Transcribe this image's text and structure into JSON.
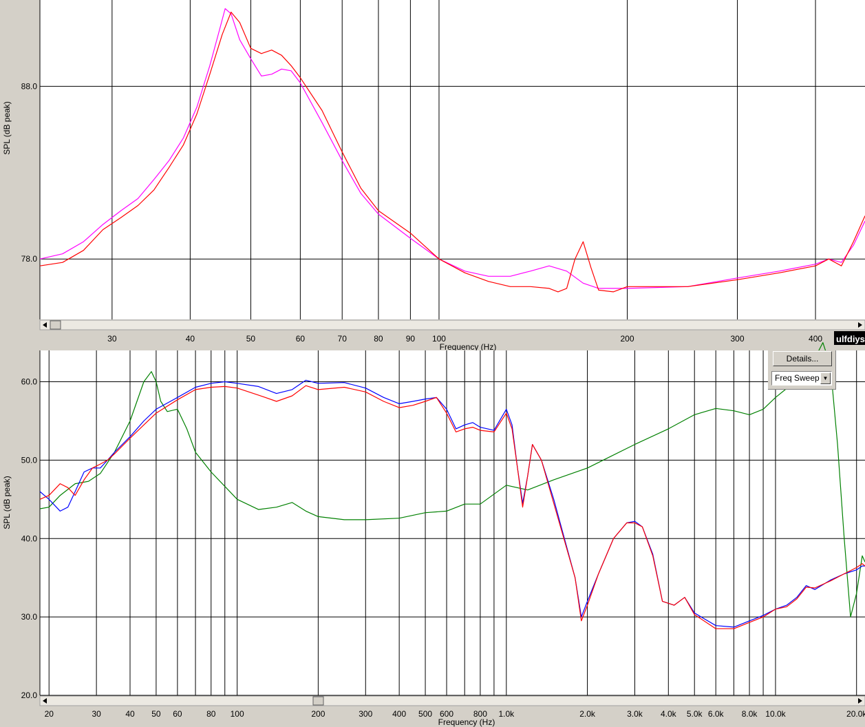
{
  "brand_text": "ulfdiys",
  "colors": {
    "background": "#d4d0c8",
    "plot_bg": "#ffffff",
    "grid": "#000000",
    "red": "#ff0000",
    "magenta": "#ff00ff",
    "blue": "#0000ff",
    "green": "#008000"
  },
  "controls": {
    "details_label": "Details...",
    "mode_value": "Freq Sweep"
  },
  "chart_data": [
    {
      "type": "line",
      "xlabel": "Frequency (Hz)",
      "ylabel": "SPL (dB peak)",
      "x_scale": "log",
      "xlim": [
        23,
        480
      ],
      "ylim": [
        74.5,
        93.0
      ],
      "x_ticks": [
        {
          "v": 30,
          "label": "30"
        },
        {
          "v": 40,
          "label": "40"
        },
        {
          "v": 50,
          "label": "50"
        },
        {
          "v": 60,
          "label": "60"
        },
        {
          "v": 70,
          "label": "70"
        },
        {
          "v": 80,
          "label": "80"
        },
        {
          "v": 90,
          "label": "90"
        },
        {
          "v": 100,
          "label": "100"
        },
        {
          "v": 200,
          "label": "200"
        },
        {
          "v": 300,
          "label": "300"
        },
        {
          "v": 400,
          "label": "400"
        }
      ],
      "y_ticks": [
        {
          "v": 78.0,
          "label": "78.0"
        },
        {
          "v": 88.0,
          "label": "88.0"
        }
      ],
      "series": [
        {
          "color": "#ff00ff",
          "x": [
            23,
            25,
            27,
            29,
            31,
            33,
            35,
            37,
            39,
            41,
            43,
            44.5,
            45.5,
            46.5,
            48,
            50,
            52,
            54,
            56,
            58,
            60,
            65,
            70,
            75,
            80,
            90,
            100,
            110,
            120,
            130,
            140,
            150,
            160,
            170,
            180,
            190,
            200,
            250,
            300,
            350,
            400,
            420,
            440,
            460,
            480
          ],
          "y": [
            78.0,
            78.3,
            79.0,
            80.0,
            80.8,
            81.5,
            82.6,
            83.7,
            85.0,
            86.8,
            89.2,
            91.2,
            92.5,
            92.2,
            90.7,
            89.6,
            88.6,
            88.7,
            89.0,
            88.9,
            88.2,
            85.9,
            83.7,
            81.8,
            80.6,
            79.2,
            78.0,
            77.3,
            77.0,
            77.0,
            77.3,
            77.6,
            77.3,
            76.6,
            76.3,
            76.3,
            76.3,
            76.4,
            76.9,
            77.3,
            77.7,
            78.0,
            77.8,
            78.8,
            80.2
          ]
        },
        {
          "color": "#ff0000",
          "x": [
            23,
            25,
            27,
            29,
            31,
            33,
            35,
            37,
            39,
            41,
            43,
            45,
            46.5,
            48,
            50,
            52,
            54,
            56,
            58,
            60,
            65,
            70,
            75,
            80,
            90,
            100,
            110,
            120,
            130,
            140,
            150,
            155,
            160,
            165,
            170,
            175,
            180,
            190,
            200,
            250,
            300,
            350,
            400,
            420,
            440,
            460,
            480
          ],
          "y": [
            77.6,
            77.8,
            78.5,
            79.7,
            80.4,
            81.1,
            82.0,
            83.3,
            84.6,
            86.4,
            88.7,
            91.0,
            92.3,
            91.7,
            90.2,
            89.9,
            90.1,
            89.8,
            89.2,
            88.5,
            86.6,
            84.2,
            82.1,
            80.8,
            79.5,
            78.0,
            77.2,
            76.7,
            76.4,
            76.4,
            76.3,
            76.1,
            76.3,
            78.0,
            79.0,
            77.5,
            76.2,
            76.1,
            76.4,
            76.4,
            76.8,
            77.2,
            77.6,
            78.0,
            77.6,
            79.0,
            80.5
          ]
        }
      ]
    },
    {
      "type": "line",
      "xlabel": "Frequency (Hz)",
      "ylabel": "SPL (dB peak)",
      "x_scale": "log",
      "xlim": [
        18.5,
        21500
      ],
      "ylim": [
        20.0,
        64.0
      ],
      "x_ticks": [
        {
          "v": 20,
          "label": "20"
        },
        {
          "v": 30,
          "label": "30"
        },
        {
          "v": 40,
          "label": "40"
        },
        {
          "v": 50,
          "label": "50"
        },
        {
          "v": 60,
          "label": "60"
        },
        {
          "v": 80,
          "label": "80"
        },
        {
          "v": 100,
          "label": "100"
        },
        {
          "v": 200,
          "label": "200"
        },
        {
          "v": 300,
          "label": "300"
        },
        {
          "v": 400,
          "label": "400"
        },
        {
          "v": 500,
          "label": "500"
        },
        {
          "v": 600,
          "label": "600"
        },
        {
          "v": 800,
          "label": "800"
        },
        {
          "v": 1000,
          "label": "1.0k"
        },
        {
          "v": 2000,
          "label": "2.0k"
        },
        {
          "v": 3000,
          "label": "3.0k"
        },
        {
          "v": 4000,
          "label": "4.0k"
        },
        {
          "v": 5000,
          "label": "5.0k"
        },
        {
          "v": 6000,
          "label": "6.0k"
        },
        {
          "v": 8000,
          "label": "8.0k"
        },
        {
          "v": 10000,
          "label": "10.0k"
        },
        {
          "v": 20000,
          "label": "20.0k"
        }
      ],
      "x_grid": [
        20,
        30,
        40,
        50,
        60,
        70,
        80,
        90,
        100,
        200,
        300,
        400,
        500,
        600,
        700,
        800,
        900,
        1000,
        2000,
        3000,
        4000,
        5000,
        6000,
        7000,
        8000,
        9000,
        10000,
        20000
      ],
      "y_ticks": [
        {
          "v": 20.0,
          "label": "20.0"
        },
        {
          "v": 30.0,
          "label": "30.0"
        },
        {
          "v": 40.0,
          "label": "40.0"
        },
        {
          "v": 50.0,
          "label": "50.0"
        },
        {
          "v": 60.0,
          "label": "60.0"
        }
      ],
      "series": [
        {
          "color": "#008000",
          "x": [
            18.5,
            20,
            22,
            25,
            28,
            31,
            35,
            40,
            45,
            48,
            50,
            52,
            55,
            60,
            65,
            70,
            80,
            100,
            120,
            140,
            160,
            180,
            200,
            250,
            300,
            400,
            500,
            600,
            700,
            800,
            1000,
            1200,
            1500,
            2000,
            3000,
            4000,
            5000,
            6000,
            7000,
            8000,
            9000,
            10000,
            12000,
            14000,
            15000,
            16000,
            17000,
            18000,
            19000,
            20000,
            21000,
            21500
          ],
          "y": [
            43.8,
            44.0,
            45.5,
            47.0,
            47.3,
            48.3,
            51.0,
            55.0,
            60.0,
            61.3,
            60.0,
            57.5,
            56.2,
            56.5,
            54.0,
            51.0,
            48.5,
            45.0,
            43.7,
            44.0,
            44.6,
            43.5,
            42.8,
            42.4,
            42.4,
            42.6,
            43.3,
            43.5,
            44.4,
            44.4,
            46.8,
            46.2,
            47.5,
            49.0,
            52.0,
            54.0,
            55.8,
            56.6,
            56.3,
            55.8,
            56.5,
            58.0,
            60.2,
            63.0,
            65.0,
            62.0,
            52.0,
            40.0,
            30.0,
            33.0,
            37.8,
            37.0
          ]
        },
        {
          "color": "#0000ff",
          "x": [
            18.5,
            20,
            22,
            23.5,
            25,
            27,
            29,
            31,
            33,
            35,
            40,
            45,
            50,
            60,
            70,
            80,
            90,
            100,
            120,
            140,
            160,
            180,
            200,
            250,
            300,
            350,
            400,
            450,
            500,
            550,
            600,
            650,
            700,
            750,
            800,
            900,
            1000,
            1050,
            1100,
            1150,
            1200,
            1250,
            1350,
            1500,
            1800,
            1900,
            2000,
            2200,
            2500,
            2800,
            3000,
            3200,
            3500,
            3800,
            4200,
            4600,
            5000,
            6000,
            7000,
            8000,
            9000,
            10000,
            11000,
            12000,
            13000,
            14000,
            16000,
            18000,
            20000,
            21000,
            21500
          ],
          "y": [
            46.0,
            45.0,
            43.5,
            44.0,
            46.0,
            48.5,
            49.0,
            49.0,
            50.0,
            51.0,
            53.0,
            55.0,
            56.5,
            58.0,
            59.3,
            59.8,
            60.0,
            59.8,
            59.4,
            58.5,
            59.0,
            60.2,
            59.8,
            59.9,
            59.2,
            58.0,
            57.2,
            57.5,
            57.8,
            58.0,
            56.5,
            54.0,
            54.5,
            54.8,
            54.2,
            53.8,
            56.5,
            54.5,
            49.0,
            44.5,
            48.0,
            52.0,
            50.0,
            45.0,
            35.0,
            30.0,
            32.0,
            35.5,
            40.0,
            42.0,
            42.2,
            41.5,
            38.0,
            32.0,
            31.5,
            32.5,
            30.5,
            28.9,
            28.7,
            29.5,
            30.2,
            31.0,
            31.5,
            32.5,
            34.0,
            33.5,
            34.7,
            35.5,
            36.0,
            36.5,
            36.5
          ]
        },
        {
          "color": "#ff0000",
          "x": [
            18.5,
            20,
            22,
            23.5,
            25,
            27,
            29,
            31,
            33,
            35,
            40,
            45,
            50,
            60,
            70,
            80,
            90,
            100,
            120,
            140,
            160,
            180,
            200,
            250,
            300,
            350,
            400,
            450,
            500,
            550,
            600,
            650,
            700,
            750,
            800,
            900,
            1000,
            1050,
            1100,
            1150,
            1200,
            1250,
            1350,
            1500,
            1800,
            1900,
            2000,
            2200,
            2500,
            2800,
            3000,
            3200,
            3500,
            3800,
            4200,
            4600,
            5000,
            6000,
            7000,
            8000,
            9000,
            10000,
            11000,
            12000,
            13000,
            14000,
            16000,
            18000,
            20000,
            21000,
            21500
          ],
          "y": [
            45.0,
            45.5,
            47.0,
            46.5,
            45.5,
            47.5,
            49.0,
            49.5,
            50.0,
            50.8,
            52.8,
            54.5,
            56.0,
            57.7,
            59.0,
            59.3,
            59.4,
            59.2,
            58.3,
            57.5,
            58.2,
            59.5,
            59.0,
            59.3,
            58.7,
            57.5,
            56.7,
            57.0,
            57.5,
            58.0,
            56.0,
            53.6,
            54.0,
            54.2,
            53.8,
            53.6,
            56.0,
            54.0,
            49.0,
            44.0,
            48.0,
            52.0,
            50.0,
            44.5,
            35.0,
            29.5,
            31.5,
            35.5,
            40.0,
            42.0,
            42.0,
            41.5,
            37.8,
            32.0,
            31.5,
            32.5,
            30.3,
            28.5,
            28.5,
            29.3,
            30.0,
            31.0,
            31.3,
            32.3,
            33.8,
            33.7,
            34.6,
            35.5,
            36.3,
            36.8,
            36.5
          ]
        }
      ]
    }
  ]
}
